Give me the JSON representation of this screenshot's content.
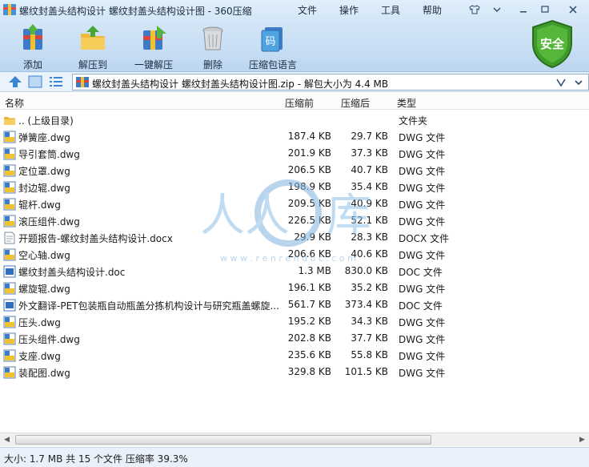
{
  "window": {
    "title": "螺纹封盖头结构设计 螺纹封盖头结构设计图 - 360压缩"
  },
  "menu": {
    "file": "文件",
    "operate": "操作",
    "tools": "工具",
    "help": "帮助"
  },
  "toolbar": {
    "add": "添加",
    "extract_to": "解压到",
    "one_click_extract": "一键解压",
    "delete": "删除",
    "compress_lang": "压缩包语言"
  },
  "security": {
    "label": "安全"
  },
  "address": {
    "path": "螺纹封盖头结构设计 螺纹封盖头结构设计图.zip - 解包大小为 4.4 MB"
  },
  "columns": {
    "name": "名称",
    "size": "压缩前",
    "packed": "压缩后",
    "type": "类型"
  },
  "files": [
    {
      "name": ".. (上级目录)",
      "size": "",
      "packed": "",
      "type": "文件夹",
      "icon": "folder-icon"
    },
    {
      "name": "弹簧座.dwg",
      "size": "187.4 KB",
      "packed": "29.7 KB",
      "type": "DWG 文件",
      "icon": "dwg-file-icon"
    },
    {
      "name": "导引套筒.dwg",
      "size": "201.9 KB",
      "packed": "37.3 KB",
      "type": "DWG 文件",
      "icon": "dwg-file-icon"
    },
    {
      "name": "定位罩.dwg",
      "size": "206.5 KB",
      "packed": "40.7 KB",
      "type": "DWG 文件",
      "icon": "dwg-file-icon"
    },
    {
      "name": "封边辊.dwg",
      "size": "198.9 KB",
      "packed": "35.4 KB",
      "type": "DWG 文件",
      "icon": "dwg-file-icon"
    },
    {
      "name": "辊杆.dwg",
      "size": "209.5 KB",
      "packed": "40.9 KB",
      "type": "DWG 文件",
      "icon": "dwg-file-icon"
    },
    {
      "name": "滚压组件.dwg",
      "size": "226.5 KB",
      "packed": "52.1 KB",
      "type": "DWG 文件",
      "icon": "dwg-file-icon"
    },
    {
      "name": "开题报告-螺纹封盖头结构设计.docx",
      "size": "29.9 KB",
      "packed": "28.3 KB",
      "type": "DOCX 文件",
      "icon": "docx-file-icon"
    },
    {
      "name": "空心轴.dwg",
      "size": "206.6 KB",
      "packed": "40.6 KB",
      "type": "DWG 文件",
      "icon": "dwg-file-icon"
    },
    {
      "name": "螺纹封盖头结构设计.doc",
      "size": "1.3 MB",
      "packed": "830.0 KB",
      "type": "DOC 文件",
      "icon": "doc-file-icon"
    },
    {
      "name": "螺旋辊.dwg",
      "size": "196.1 KB",
      "packed": "35.2 KB",
      "type": "DWG 文件",
      "icon": "dwg-file-icon"
    },
    {
      "name": "外文翻译-PET包装瓶自动瓶盖分拣机构设计与研究瓶盖螺旋...",
      "size": "561.7 KB",
      "packed": "373.4 KB",
      "type": "DOC 文件",
      "icon": "doc-file-icon"
    },
    {
      "name": "压头.dwg",
      "size": "195.2 KB",
      "packed": "34.3 KB",
      "type": "DWG 文件",
      "icon": "dwg-file-icon"
    },
    {
      "name": "压头组件.dwg",
      "size": "202.8 KB",
      "packed": "37.7 KB",
      "type": "DWG 文件",
      "icon": "dwg-file-icon"
    },
    {
      "name": "支座.dwg",
      "size": "235.6 KB",
      "packed": "55.8 KB",
      "type": "DWG 文件",
      "icon": "dwg-file-icon"
    },
    {
      "name": "装配图.dwg",
      "size": "329.8 KB",
      "packed": "101.5 KB",
      "type": "DWG 文件",
      "icon": "dwg-file-icon"
    }
  ],
  "watermark": {
    "text": "人人文库",
    "url": "w w w . r e n r e n d o c . c o m"
  },
  "status": {
    "text": "大小: 1.7 MB 共 15 个文件 压缩率 39.3%"
  }
}
